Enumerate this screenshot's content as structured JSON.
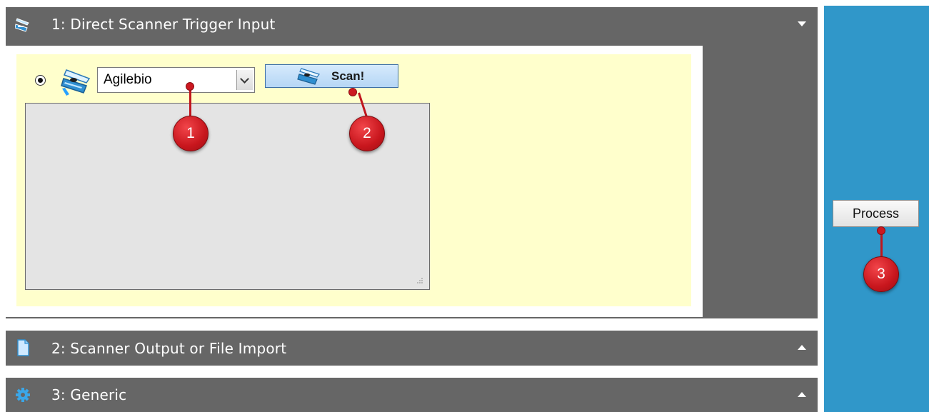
{
  "sections": [
    {
      "number_title": "1: Direct Scanner Trigger Input",
      "icon": "scanner-icon",
      "state": "expanded"
    },
    {
      "number_title": "2: Scanner Output or File Import",
      "icon": "document-icon",
      "state": "collapsed"
    },
    {
      "number_title": "3: Generic",
      "icon": "gear-icon",
      "state": "collapsed"
    }
  ],
  "scanner_input": {
    "radio_selected": true,
    "scanner_select": {
      "value": "Agilebio"
    },
    "scan_button": {
      "label": "Scan!"
    },
    "scan_output_text": ""
  },
  "process_button": {
    "label": "Process"
  },
  "callouts": [
    "1",
    "2",
    "3"
  ],
  "colors": {
    "section_header": "#666666",
    "right_panel": "#3097c9",
    "input_panel": "#ffffcc",
    "callout": "#cc1820",
    "scan_button": "#c6e1f8"
  }
}
